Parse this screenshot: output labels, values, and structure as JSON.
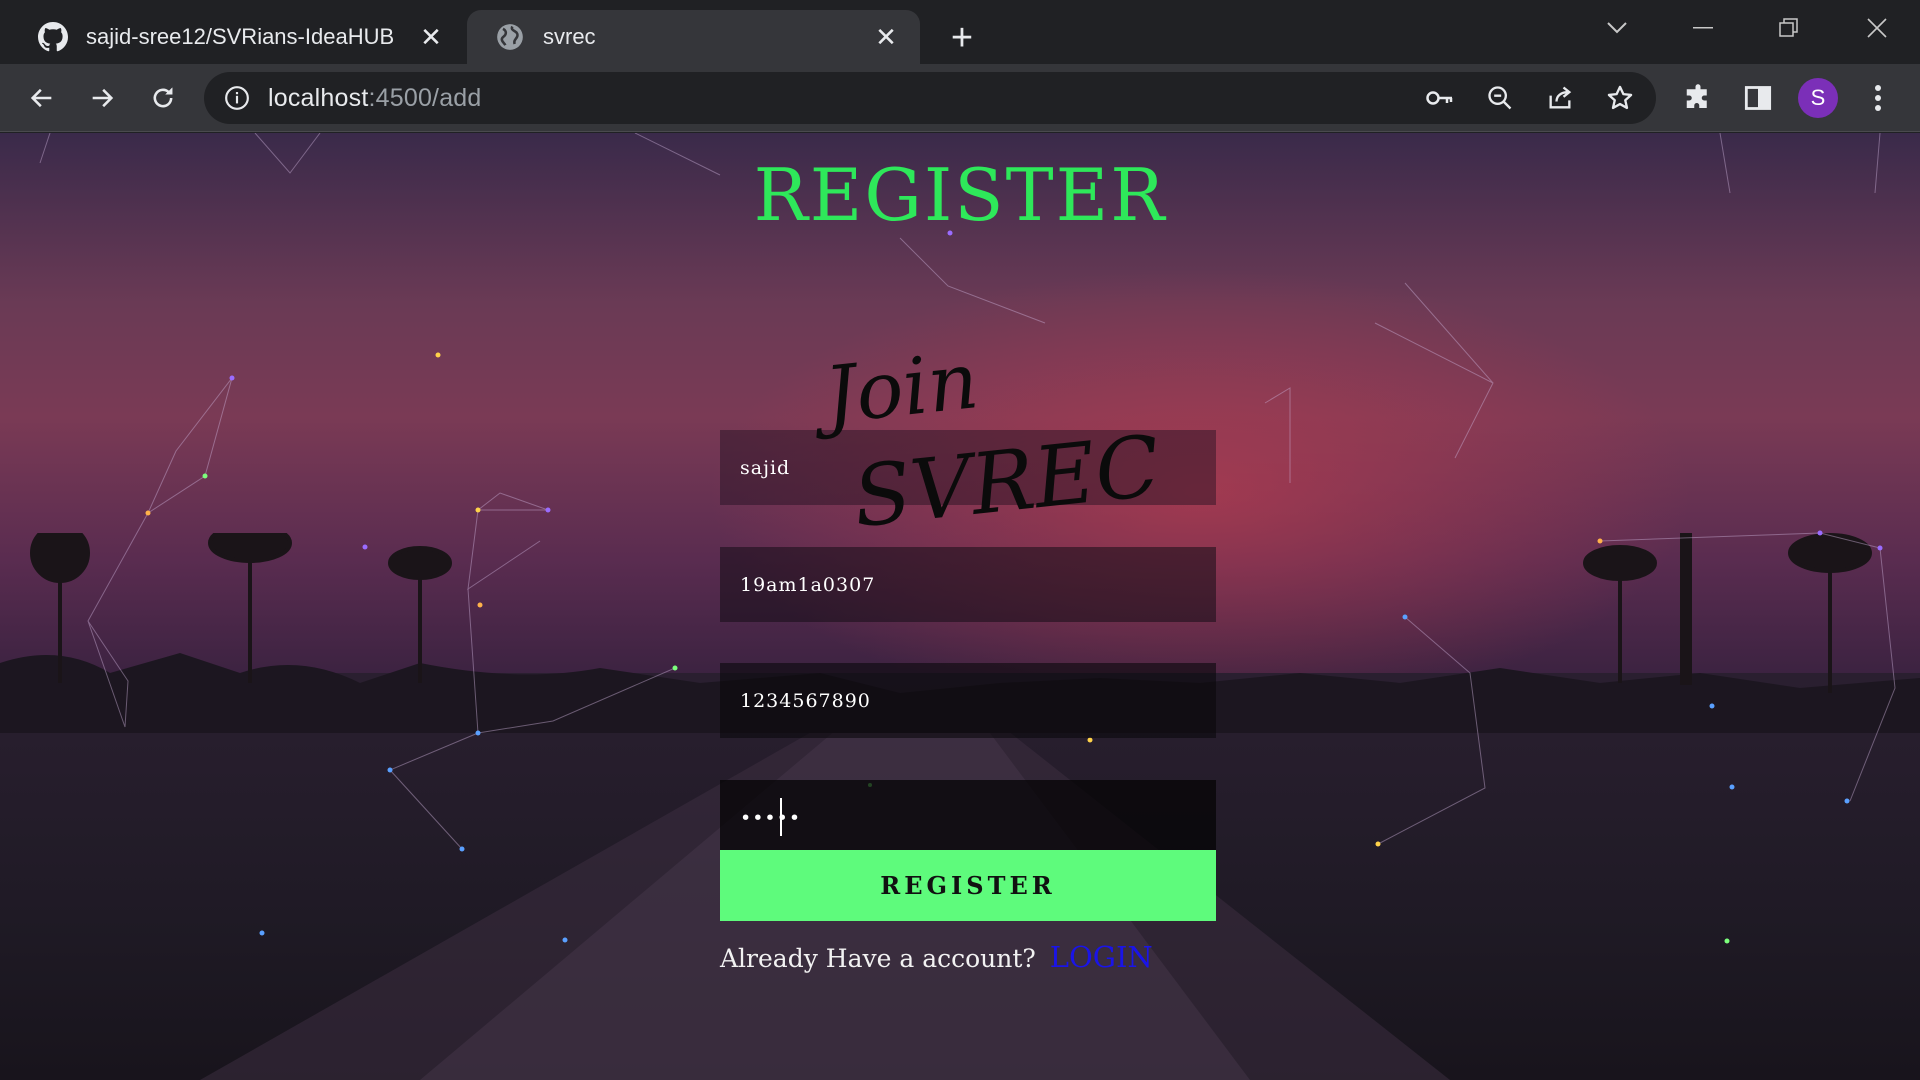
{
  "browser": {
    "tabs": [
      {
        "title": "sajid-sree12/SVRians-IdeaHUB",
        "icon": "github-icon",
        "active": false
      },
      {
        "title": "svrec",
        "icon": "globe-icon",
        "active": true
      }
    ],
    "url_host": "localhost",
    "url_path": ":4500/add",
    "profile_initial": "S",
    "profile_color": "#7b2fb8"
  },
  "page": {
    "title": "REGISTER",
    "brand_line1": "Join",
    "brand_line2": "SVREC",
    "form": {
      "name_value": "sajid",
      "roll_value": "19am1a0307",
      "phone_value": "1234567890",
      "password_value": "•••••",
      "submit_label": "REGISTER",
      "login_prompt": "Already Have a account?",
      "login_link": "LOGIN"
    },
    "colors": {
      "title": "#2ee85a",
      "button": "#5efb7c",
      "link": "#1a14e8"
    }
  }
}
